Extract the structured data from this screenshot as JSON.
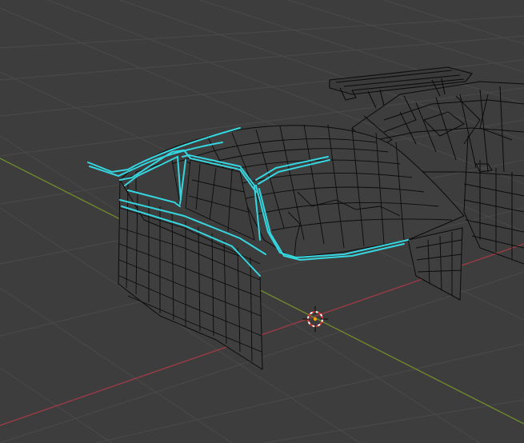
{
  "viewport": {
    "mode": "3d-viewport-edit-mesh-wireframe",
    "background_color": "#3d3d3d",
    "grid_color": "#4a4a4a",
    "x_axis_color": "#9b3b45",
    "y_axis_color": "#6d8a2b",
    "wire_color": "#0b0b0b",
    "selected_edge_color": "#36d6e0",
    "cursor_icon": "3d-cursor-icon"
  }
}
